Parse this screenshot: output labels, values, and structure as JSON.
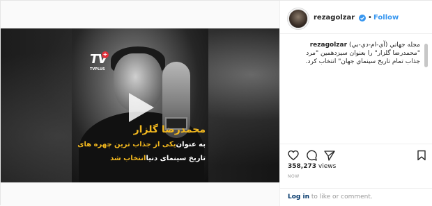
{
  "post": {
    "username": "rezagolzar",
    "follow_label": "Follow",
    "separator": "•",
    "caption_user": "rezagolzar",
    "caption_line1": "مجله جهاني (آي-ام-دي-بي)",
    "caption_line2": "\"محمدرضا گلزار\" را بعنوان سيزدهمين \"مرد",
    "caption_line3": "جذاب تمام تاريخ سينماي جهان\" انتخاب کرد.",
    "views_count": "358,273",
    "views_label": "views",
    "timestamp": "NOW",
    "login_link": "Log in",
    "login_text": "to like or comment."
  },
  "video": {
    "logo_text": "TV",
    "logo_plus": "+",
    "logo_sub": "TVPLUS",
    "overlay_name": "محمدرضا گلزار",
    "overlay_line1_a": "به عنوان ",
    "overlay_line1_b": "یکی از جذاب ترین چهره های",
    "overlay_line2_a": "تاریخ سینمای دنیا ",
    "overlay_line2_b": "انتخاب شد"
  },
  "icons": {
    "play": "play-icon",
    "like": "heart-icon",
    "comment": "comment-icon",
    "share": "share-icon",
    "save": "bookmark-icon",
    "verified": "verified-badge-icon"
  },
  "colors": {
    "follow": "#3897f0",
    "verified": "#3897f0",
    "overlay_accent": "#f2b81f",
    "logo_plus": "#e0303a"
  }
}
